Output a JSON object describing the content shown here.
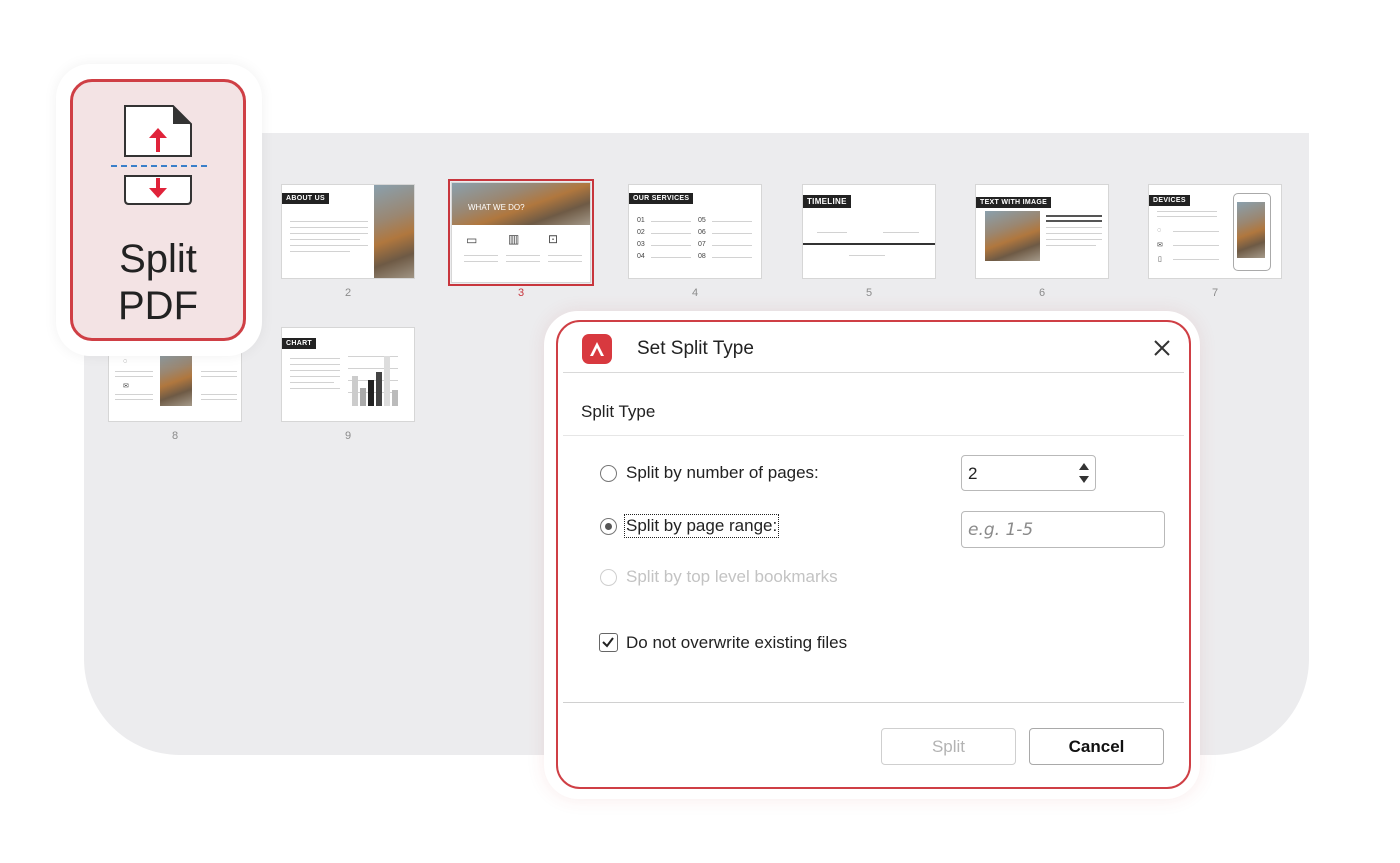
{
  "tool": {
    "label_line1": "Split",
    "label_line2": "PDF",
    "icon": "split-pdf-icon"
  },
  "thumbnails": [
    {
      "page": "2",
      "title": "ABOUT US"
    },
    {
      "page": "3",
      "title": "WHAT WE DO?",
      "selected": true
    },
    {
      "page": "4",
      "title": "OUR SERVICES",
      "items": [
        "01",
        "05",
        "02",
        "06",
        "03",
        "07",
        "04",
        "08"
      ]
    },
    {
      "page": "5",
      "title": "TIMELINE"
    },
    {
      "page": "6",
      "title": "TEXT WITH IMAGE"
    },
    {
      "page": "7",
      "title": "DEVICES"
    },
    {
      "page": "8",
      "title": ""
    },
    {
      "page": "9",
      "title": "CHART"
    }
  ],
  "dialog": {
    "title": "Set Split Type",
    "section": "Split Type",
    "options": [
      {
        "label": "Split by number of pages:",
        "checked": false,
        "enabled": true
      },
      {
        "label": "Split by page range:",
        "checked": true,
        "enabled": true
      },
      {
        "label": "Split by top level bookmarks",
        "checked": false,
        "enabled": false
      }
    ],
    "pages_value": "2",
    "range_placeholder": "e.g. 1-5",
    "checkbox_label": "Do not overwrite existing files",
    "checkbox_checked": true,
    "split_label": "Split",
    "cancel_label": "Cancel"
  },
  "colors": {
    "accent": "#cf3f45",
    "panel": "#ececee"
  }
}
